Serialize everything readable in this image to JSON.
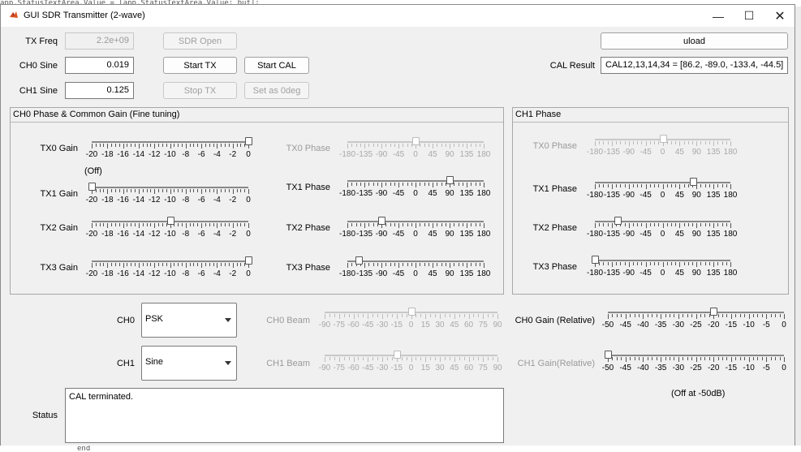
{
  "background_code_top": "app.StatusTextArea.Value = [app.StatusTextArea.Value; buf];",
  "background_code_bottom": "end",
  "window": {
    "title": "GUI SDR Transmitter (2-wave)"
  },
  "top": {
    "tx_freq_label": "TX Freq",
    "tx_freq_value": "2.2e+09",
    "ch0_sine_label": "CH0 Sine",
    "ch0_sine_value": "0.019",
    "ch1_sine_label": "CH1 Sine",
    "ch1_sine_value": "0.125",
    "sdr_open": "SDR Open",
    "start_tx": "Start TX",
    "stop_tx": "Stop TX",
    "start_cal": "Start CAL",
    "set_0deg": "Set as 0deg",
    "uload": "uload",
    "cal_result_label": "CAL Result",
    "cal_result_value": "CAL12,13,14,34 = [86.2, -89.0, -133.4, -44.5]"
  },
  "panel0": {
    "title": "CH0 Phase & Common Gain (Fine tuning)",
    "gain_labels": [
      "TX0 Gain",
      "TX1 Gain",
      "TX2 Gain",
      "TX3 Gain"
    ],
    "gain_values": [
      0,
      -20,
      -10,
      0
    ],
    "tx1_off_note": "(Off)",
    "phase_labels": [
      "TX0 Phase",
      "TX1 Phase",
      "TX2 Phase",
      "TX3 Phase"
    ],
    "phase_values": [
      0,
      90,
      -90,
      -150
    ]
  },
  "panel1": {
    "title": "CH1 Phase",
    "phase_labels": [
      "TX0 Phase",
      "TX1 Phase",
      "TX2 Phase",
      "TX3 Phase"
    ],
    "phase_values": [
      0,
      80,
      -120,
      -180
    ]
  },
  "gain_ticks": [
    "-20",
    "-18",
    "-16",
    "-14",
    "-12",
    "-10",
    "-8",
    "-6",
    "-4",
    "-2",
    "0"
  ],
  "phase_ticks": [
    "-180",
    "-135",
    "-90",
    "-45",
    "0",
    "45",
    "90",
    "135",
    "180"
  ],
  "beam_ticks": [
    "-90",
    "-75",
    "-60",
    "-45",
    "-30",
    "-15",
    "0",
    "15",
    "30",
    "45",
    "60",
    "75",
    "90"
  ],
  "relgain_ticks": [
    "-50",
    "-45",
    "-40",
    "-35",
    "-30",
    "-25",
    "-20",
    "-15",
    "-10",
    "-5",
    "0"
  ],
  "bottom": {
    "ch0_label": "CH0",
    "ch0_mode": "PSK",
    "ch1_label": "CH1",
    "ch1_mode": "Sine",
    "ch0_beam_label": "CH0 Beam",
    "ch0_beam_value": 0,
    "ch1_beam_label": "CH1 Beam",
    "ch1_beam_value": -15,
    "ch0_gain_label": "CH0 Gain (Relative)",
    "ch0_gain_value": -20,
    "ch1_gain_label": "CH1 Gain(Relative)",
    "ch1_gain_value": -50,
    "off_note": "(Off at -50dB)",
    "status_label": "Status",
    "status_text": "CAL terminated."
  }
}
